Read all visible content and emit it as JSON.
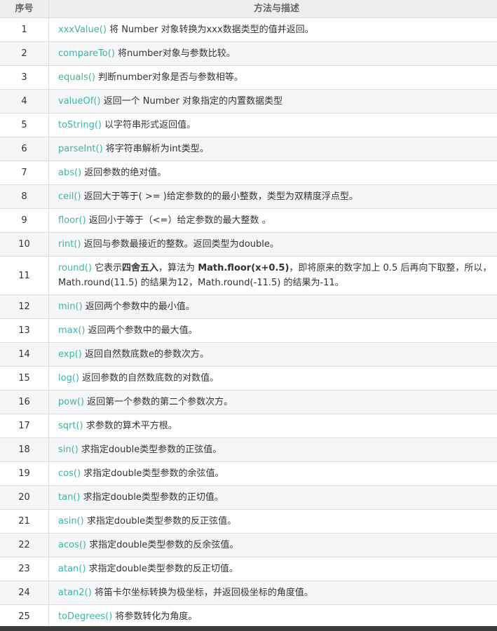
{
  "header": {
    "num": "序号",
    "desc": "方法与描述"
  },
  "rows": [
    {
      "num": "1",
      "method": "xxxValue()",
      "text": " 将 Number 对象转换为xxx数据类型的值并返回。"
    },
    {
      "num": "2",
      "method": "compareTo()",
      "text": " 将number对象与参数比较。"
    },
    {
      "num": "3",
      "method": "equals()",
      "text": " 判断number对象是否与参数相等。"
    },
    {
      "num": "4",
      "method": "valueOf()",
      "text": " 返回一个 Number 对象指定的内置数据类型"
    },
    {
      "num": "5",
      "method": "toString()",
      "text": " 以字符串形式返回值。"
    },
    {
      "num": "6",
      "method": "parseInt()",
      "text": " 将字符串解析为int类型。"
    },
    {
      "num": "7",
      "method": "abs()",
      "text": " 返回参数的绝对值。"
    },
    {
      "num": "8",
      "method": "ceil()",
      "text": " 返回大于等于( >= )给定参数的的最小整数，类型为双精度浮点型。"
    },
    {
      "num": "9",
      "method": "floor()",
      "text": " 返回小于等于（<=）给定参数的最大整数 。"
    },
    {
      "num": "10",
      "method": "rint()",
      "text": " 返回与参数最接近的整数。返回类型为double。"
    },
    {
      "num": "11",
      "method": "round()",
      "t1": " 它表示",
      "b1": "四舍五入",
      "t2": "，算法为 ",
      "b2": "Math.floor(x+0.5)",
      "t3": "，即将原来的数字加上 0.5 后再向下取整，所以，",
      "line2": "Math.round(11.5) 的结果为12，Math.round(-11.5) 的结果为-11。"
    },
    {
      "num": "12",
      "method": "min()",
      "text": " 返回两个参数中的最小值。"
    },
    {
      "num": "13",
      "method": "max()",
      "text": " 返回两个参数中的最大值。"
    },
    {
      "num": "14",
      "method": "exp()",
      "text": " 返回自然数底数e的参数次方。"
    },
    {
      "num": "15",
      "method": "log()",
      "text": " 返回参数的自然数底数的对数值。"
    },
    {
      "num": "16",
      "method": "pow()",
      "text": " 返回第一个参数的第二个参数次方。"
    },
    {
      "num": "17",
      "method": "sqrt()",
      "text": " 求参数的算术平方根。"
    },
    {
      "num": "18",
      "method": "sin()",
      "text": " 求指定double类型参数的正弦值。"
    },
    {
      "num": "19",
      "method": "cos()",
      "text": " 求指定double类型参数的余弦值。"
    },
    {
      "num": "20",
      "method": "tan()",
      "text": " 求指定double类型参数的正切值。"
    },
    {
      "num": "21",
      "method": "asin()",
      "text": " 求指定double类型参数的反正弦值。"
    },
    {
      "num": "22",
      "method": "acos()",
      "text": " 求指定double类型参数的反余弦值。"
    },
    {
      "num": "23",
      "method": "atan()",
      "text": " 求指定double类型参数的反正切值。"
    },
    {
      "num": "24",
      "method": "atan2()",
      "text": " 将笛卡尔坐标转换为极坐标，并返回极坐标的角度值。"
    },
    {
      "num": "25",
      "method": "toDegrees()",
      "text": " 将参数转化为角度。"
    }
  ]
}
